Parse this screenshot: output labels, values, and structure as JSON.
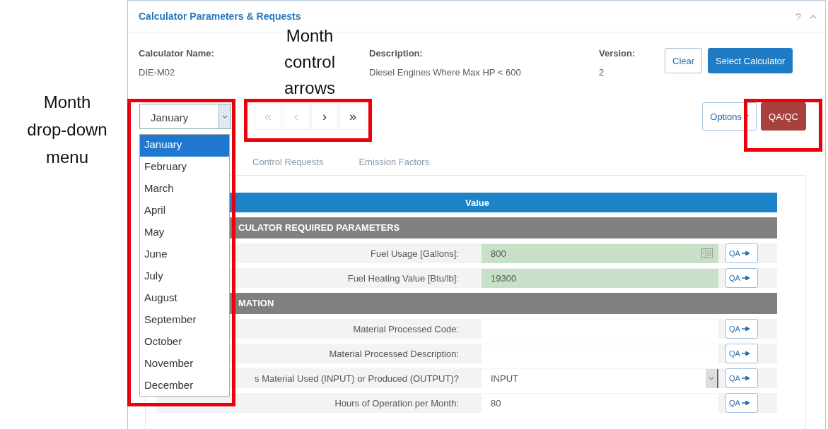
{
  "annotations": [
    {
      "kind": "side",
      "label": "Month drop-down menu"
    },
    {
      "kind": "above",
      "label": "Month control arrows"
    }
  ],
  "panel": {
    "title": "Calculator Parameters & Requests",
    "help": "?"
  },
  "info": [
    {
      "label": "Calculator Name:",
      "value": "DIE-M02"
    },
    {
      "label": "Description:",
      "value": "Diesel Engines Where Max HP < 600"
    },
    {
      "label": "Version:",
      "value": "2"
    }
  ],
  "buttons": [
    {
      "kind": "outline",
      "label": "Clear"
    },
    {
      "kind": "primary",
      "label": "Select Calculator"
    }
  ],
  "month_select": {
    "value": "January",
    "expanded": true,
    "options": [
      {
        "label": "January",
        "selected": true
      },
      {
        "label": "February",
        "selected": false
      },
      {
        "label": "March",
        "selected": false
      },
      {
        "label": "April",
        "selected": false
      },
      {
        "label": "May",
        "selected": false
      },
      {
        "label": "June",
        "selected": false
      },
      {
        "label": "July",
        "selected": false
      },
      {
        "label": "August",
        "selected": false
      },
      {
        "label": "September",
        "selected": false
      },
      {
        "label": "October",
        "selected": false
      },
      {
        "label": "November",
        "selected": false
      },
      {
        "label": "December",
        "selected": false
      }
    ]
  },
  "month_nav": [
    {
      "label": "«",
      "disabled": true
    },
    {
      "label": "‹",
      "disabled": true
    },
    {
      "label": "›",
      "disabled": false
    },
    {
      "label": "»",
      "disabled": false
    }
  ],
  "actions": [
    {
      "kind": "dropdown",
      "label": "Options"
    },
    {
      "kind": "danger",
      "label": "QA/QC"
    }
  ],
  "tabs": [
    {
      "label": "Control Requests",
      "selected": false
    },
    {
      "label": "Emission Factors",
      "selected": false
    }
  ],
  "table": {
    "header": "Value",
    "rows": [
      {
        "kind": "section",
        "label": "CULATOR REQUIRED PARAMETERS"
      },
      {
        "kind": "input",
        "label": "Fuel Usage [Gallons]:",
        "value": "800",
        "prefilled": true,
        "has_icon": true,
        "qa": "QA"
      },
      {
        "kind": "input",
        "label": "Fuel Heating Value [Btu/lb]:",
        "value": "19300",
        "prefilled": true,
        "has_icon": false,
        "qa": "QA"
      },
      {
        "kind": "section",
        "label": "MATION"
      },
      {
        "kind": "input",
        "label": "Material Processed Code:",
        "prefilled": false,
        "has_icon": false,
        "qa": "QA"
      },
      {
        "kind": "input",
        "label": "Material Processed Description:",
        "prefilled": false,
        "has_icon": false,
        "qa": "QA"
      },
      {
        "kind": "select",
        "label": "s Material Used (INPUT) or Produced (OUTPUT)?",
        "value": "INPUT",
        "qa": "QA"
      },
      {
        "kind": "input",
        "label": "Hours of Operation per Month:",
        "value": "80",
        "prefilled": false,
        "has_icon": false,
        "qa": "QA"
      }
    ]
  }
}
